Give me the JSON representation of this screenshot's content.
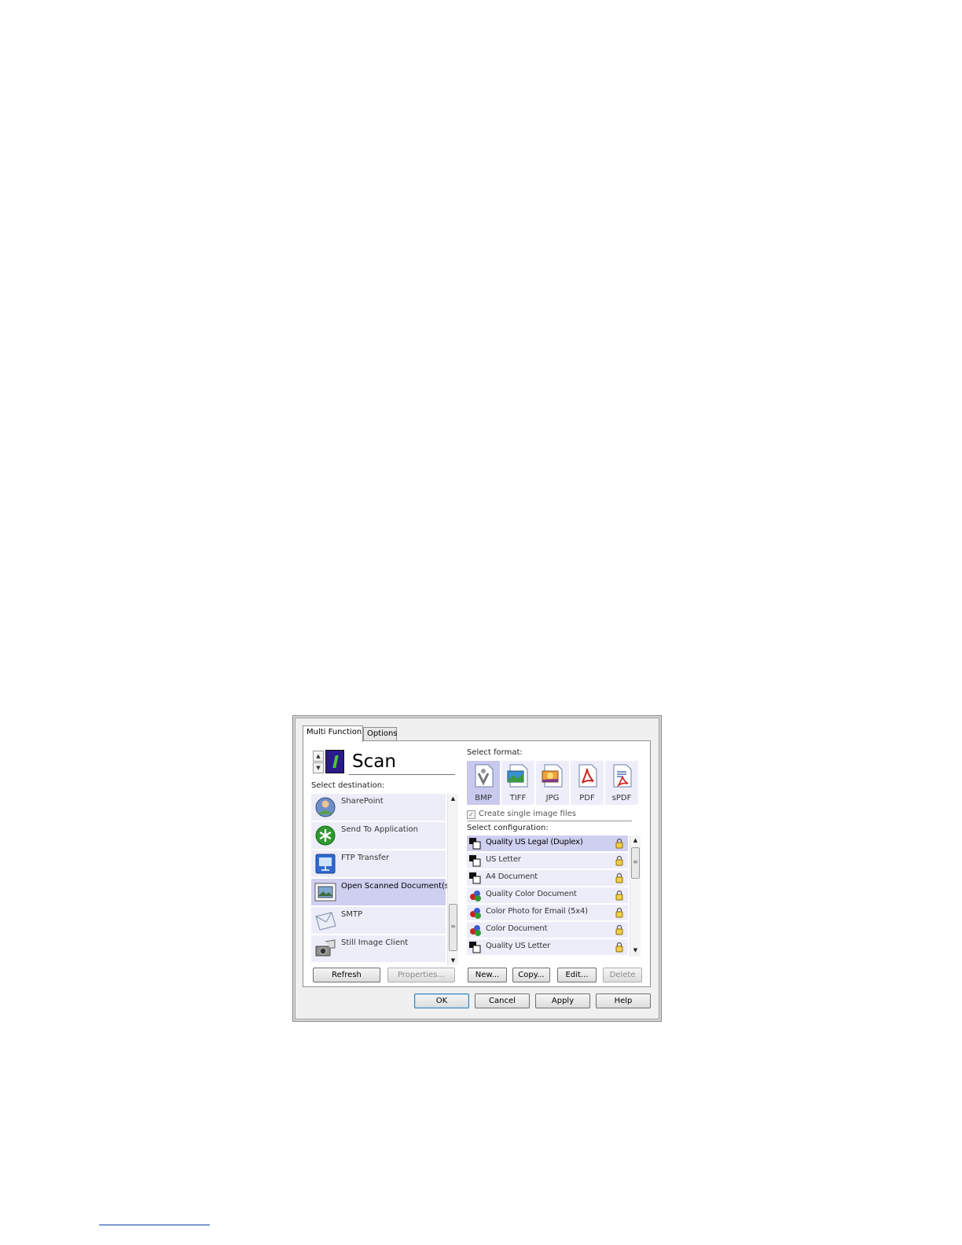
{
  "tabs": [
    {
      "label": "Multi Function",
      "active": true
    },
    {
      "label": "Options",
      "active": false
    }
  ],
  "scan": {
    "title": "Scan",
    "spin_up": "▲",
    "spin_down": "▼"
  },
  "destination": {
    "label": "Select destination:",
    "items": [
      {
        "label": "SharePoint",
        "icon": "sharepoint-icon",
        "selected": false
      },
      {
        "label": "Send To Application",
        "icon": "send-to-application-icon",
        "selected": false
      },
      {
        "label": "FTP Transfer",
        "icon": "ftp-transfer-icon",
        "selected": false
      },
      {
        "label": "Open Scanned Document(s)",
        "icon": "open-scanned-document-icon",
        "selected": true
      },
      {
        "label": "SMTP",
        "icon": "smtp-icon",
        "selected": false
      },
      {
        "label": "Still Image Client",
        "icon": "still-image-client-icon",
        "selected": false
      }
    ],
    "refresh": "Refresh",
    "properties": "Properties..."
  },
  "format": {
    "label": "Select format:",
    "items": [
      {
        "label": "BMP",
        "selected": true
      },
      {
        "label": "TIFF",
        "selected": false
      },
      {
        "label": "JPG",
        "selected": false
      },
      {
        "label": "PDF",
        "selected": false
      },
      {
        "label": "sPDF",
        "selected": false
      }
    ],
    "single_image_files": "Create single image files",
    "single_image_checked": true
  },
  "configuration": {
    "label": "Select configuration:",
    "items": [
      {
        "label": "Quality US Legal (Duplex)",
        "kind": "bw",
        "selected": true
      },
      {
        "label": "US Letter",
        "kind": "bw",
        "selected": false
      },
      {
        "label": "A4 Document",
        "kind": "bw",
        "selected": false
      },
      {
        "label": "Quality Color Document",
        "kind": "color",
        "selected": false
      },
      {
        "label": "Color Photo for Email (5x4)",
        "kind": "color",
        "selected": false
      },
      {
        "label": "Color Document",
        "kind": "color",
        "selected": false
      },
      {
        "label": "Quality US Letter",
        "kind": "bw",
        "selected": false
      }
    ],
    "new": "New...",
    "copy": "Copy...",
    "edit": "Edit...",
    "delete": "Delete"
  },
  "footer": {
    "ok": "OK",
    "cancel": "Cancel",
    "apply": "Apply",
    "help": "Help"
  },
  "colors": {
    "selection": "#cfcff0",
    "list_bg": "#ededfa",
    "accent_blue": "#2a1a8a"
  }
}
